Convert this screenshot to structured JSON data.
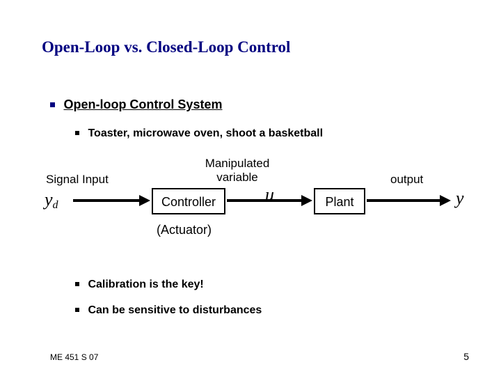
{
  "title": "Open-Loop vs. Closed-Loop Control",
  "bullets": {
    "main": "Open-loop Control System",
    "sub1": "Toaster, microwave oven, shoot a basketball",
    "sub2": "Calibration is the key!",
    "sub3": "Can be sensitive to disturbances"
  },
  "diagram": {
    "signal_input": "Signal Input",
    "yd_base": "y",
    "yd_sub": "d",
    "manipulated_l1": "Manipulated",
    "manipulated_l2": "variable",
    "controller": "Controller",
    "actuator": "(Actuator)",
    "u": "u",
    "plant": "Plant",
    "output": "output",
    "y": "y"
  },
  "footer": {
    "left": "ME 451 S 07",
    "right": "5"
  }
}
